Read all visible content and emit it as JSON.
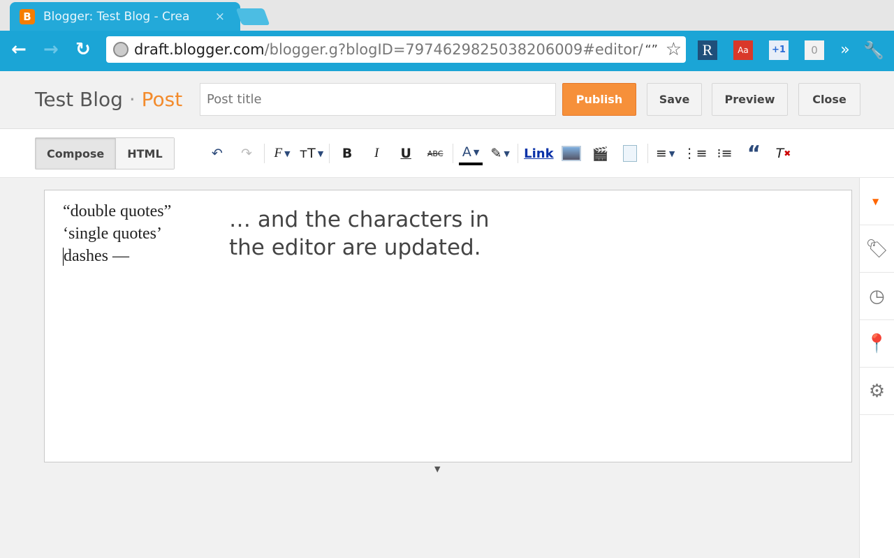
{
  "browser": {
    "tab_title": "Blogger: Test Blog - Crea",
    "url_host": "draft.blogger.com",
    "url_path": "/blogger.g?blogID=7974629825038206009#editor/",
    "extensions": [
      {
        "name": "R",
        "color": "#1f4f7a"
      },
      {
        "name": "Aa",
        "color": "#d9382a"
      },
      {
        "name": "+1",
        "color": "#2a6bd6"
      },
      {
        "name": "0",
        "color": "#999"
      }
    ]
  },
  "header": {
    "blog_name": "Test Blog",
    "separator": " · ",
    "section": "Post",
    "title_placeholder": "Post title",
    "publish": "Publish",
    "save": "Save",
    "preview": "Preview",
    "close": "Close"
  },
  "editor": {
    "mode_compose": "Compose",
    "mode_html": "HTML",
    "link_label": "Link",
    "lines": [
      "“double quotes”",
      "‘single quotes’",
      "dashes —"
    ],
    "caption_lines": [
      "… and the characters in",
      "the editor are updated."
    ]
  },
  "colors": {
    "accent": "#f6903a",
    "browser": "#1ba5d6"
  }
}
